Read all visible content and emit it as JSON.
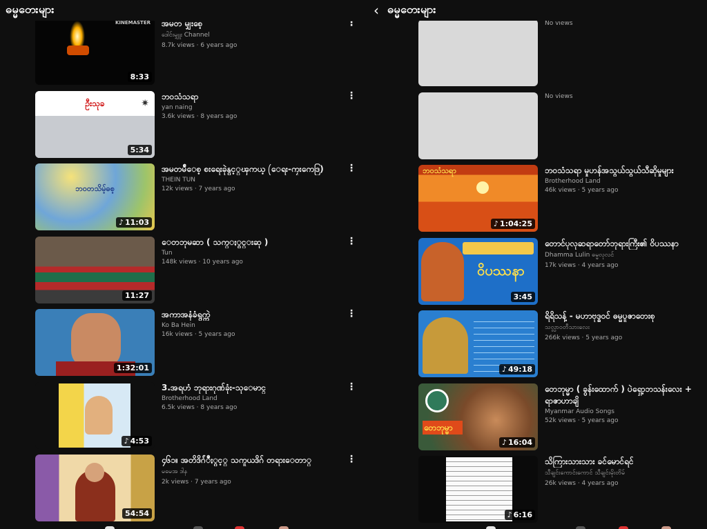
{
  "left": {
    "title": "ဓမ္မတေးများ",
    "videos": [
      {
        "title": "အမတ မျှးစေ့",
        "channel": "ဒေါင်းမျှူး Channel",
        "views": "8.7k views",
        "age": "6 years ago",
        "duration": "8:33",
        "music": false,
        "watermark": "KINEMASTER"
      },
      {
        "title": "ဘဝသံသရာ",
        "channel": "yan naing",
        "views": "3.6k views",
        "age": "8 years ago",
        "duration": "5:34",
        "music": false,
        "thumb_caption": "ဦးသုခ"
      },
      {
        "title": "အမတမ်ဳေစ့ စးရေးခုဲနွင့္ၾကယ့ (ေရး-ကၠးကေဒြ)",
        "channel": "THEIN TUN",
        "views": "12k views",
        "age": "7 years ago",
        "duration": "11:03",
        "music": true,
        "thumb_caption": "ဘဝတသိမ့်ဓစ့"
      },
      {
        "title": "ေတဘုမဆာ ( သက္ႏွင္းဆု )",
        "channel": "Tun",
        "views": "148k views",
        "age": "10 years ago",
        "duration": "11:27",
        "music": false
      },
      {
        "title": "အကာအနံခံရွက္ကဲ",
        "channel": "Ko Ba Hein",
        "views": "16k views",
        "age": "5 years ago",
        "duration": "1:32:01",
        "music": false
      },
      {
        "title": "3.အရဟံ ဘုရားဂုဏ်ခုံး-သုေမာင္",
        "channel": "Brotherhood Land",
        "views": "6.5k views",
        "age": "8 years ago",
        "duration": "4:53",
        "music": true
      },
      {
        "title": "၄၆၁။ အတိဒိဂ်ံဳႏွင့္ သကူယဒိဂ် တရားေတာ္",
        "channel": "မမေအ ဒါန",
        "views": "2k views",
        "age": "7 years ago",
        "duration": "54:54",
        "music": false
      }
    ]
  },
  "right": {
    "title": "ဓမ္မတေးများ",
    "back_icon": "‹",
    "videos": [
      {
        "title": "",
        "channel": "",
        "views": "No views",
        "age": "",
        "duration": "",
        "music": false,
        "blank": true
      },
      {
        "title": "",
        "channel": "",
        "views": "No views",
        "age": "",
        "duration": "",
        "music": false,
        "blank": true
      },
      {
        "title": "ဘဝသံသရာ မှုဟန်အသွယ်သွယ်သီဆိုမှုများ",
        "channel": "Brotherhood Land",
        "views": "46k views",
        "age": "5 years ago",
        "duration": "1:04:25",
        "music": true,
        "thumb_caption": "ဘဝသံသရာ"
      },
      {
        "title": "တောင်ပုလုဆရာတော်ဘုရားကြီး၏ ဝိပဿနာ",
        "channel": "Dhamma Lulin ဓမ္မလုလင်",
        "views": "17k views",
        "age": "4 years ago",
        "duration": "3:45",
        "music": false,
        "thumb_caption": "ဝိပဿနာ"
      },
      {
        "title": "ရိရိသန့် - မဟာဗုဒ္ဓဝင် ဓမ္မပူဇာတေးစု",
        "channel": "သလ္လာဝတီသားလေး",
        "views": "266k views",
        "age": "5 years ago",
        "duration": "49:18",
        "music": true
      },
      {
        "title": "တေဘုမ္မာ ( ခွန်းထောက် ) ပဲရှော့ဘသန်းလေး + ရာဇာဟာချိ",
        "channel": "Myanmar Audio Songs",
        "views": "52k views",
        "age": "5 years ago",
        "duration": "16:04",
        "music": true,
        "thumb_caption": "တေဘုမ္မာ"
      },
      {
        "title": "သိကြားသားသား ခင်မောင်ရင်",
        "channel": "သီချင်းကောင်းကောင် သီချင်းမိုးတိမ်",
        "views": "26k views",
        "age": "4 years ago",
        "duration": "6:16",
        "music": true
      }
    ]
  },
  "colors": {
    "background": "#0f0f0f",
    "text_primary": "#f1f1f1",
    "text_secondary": "#aaaaaa"
  },
  "icons": {
    "menu": "more-vert-icon",
    "music": "music-note-icon",
    "back": "back-arrow-icon"
  }
}
